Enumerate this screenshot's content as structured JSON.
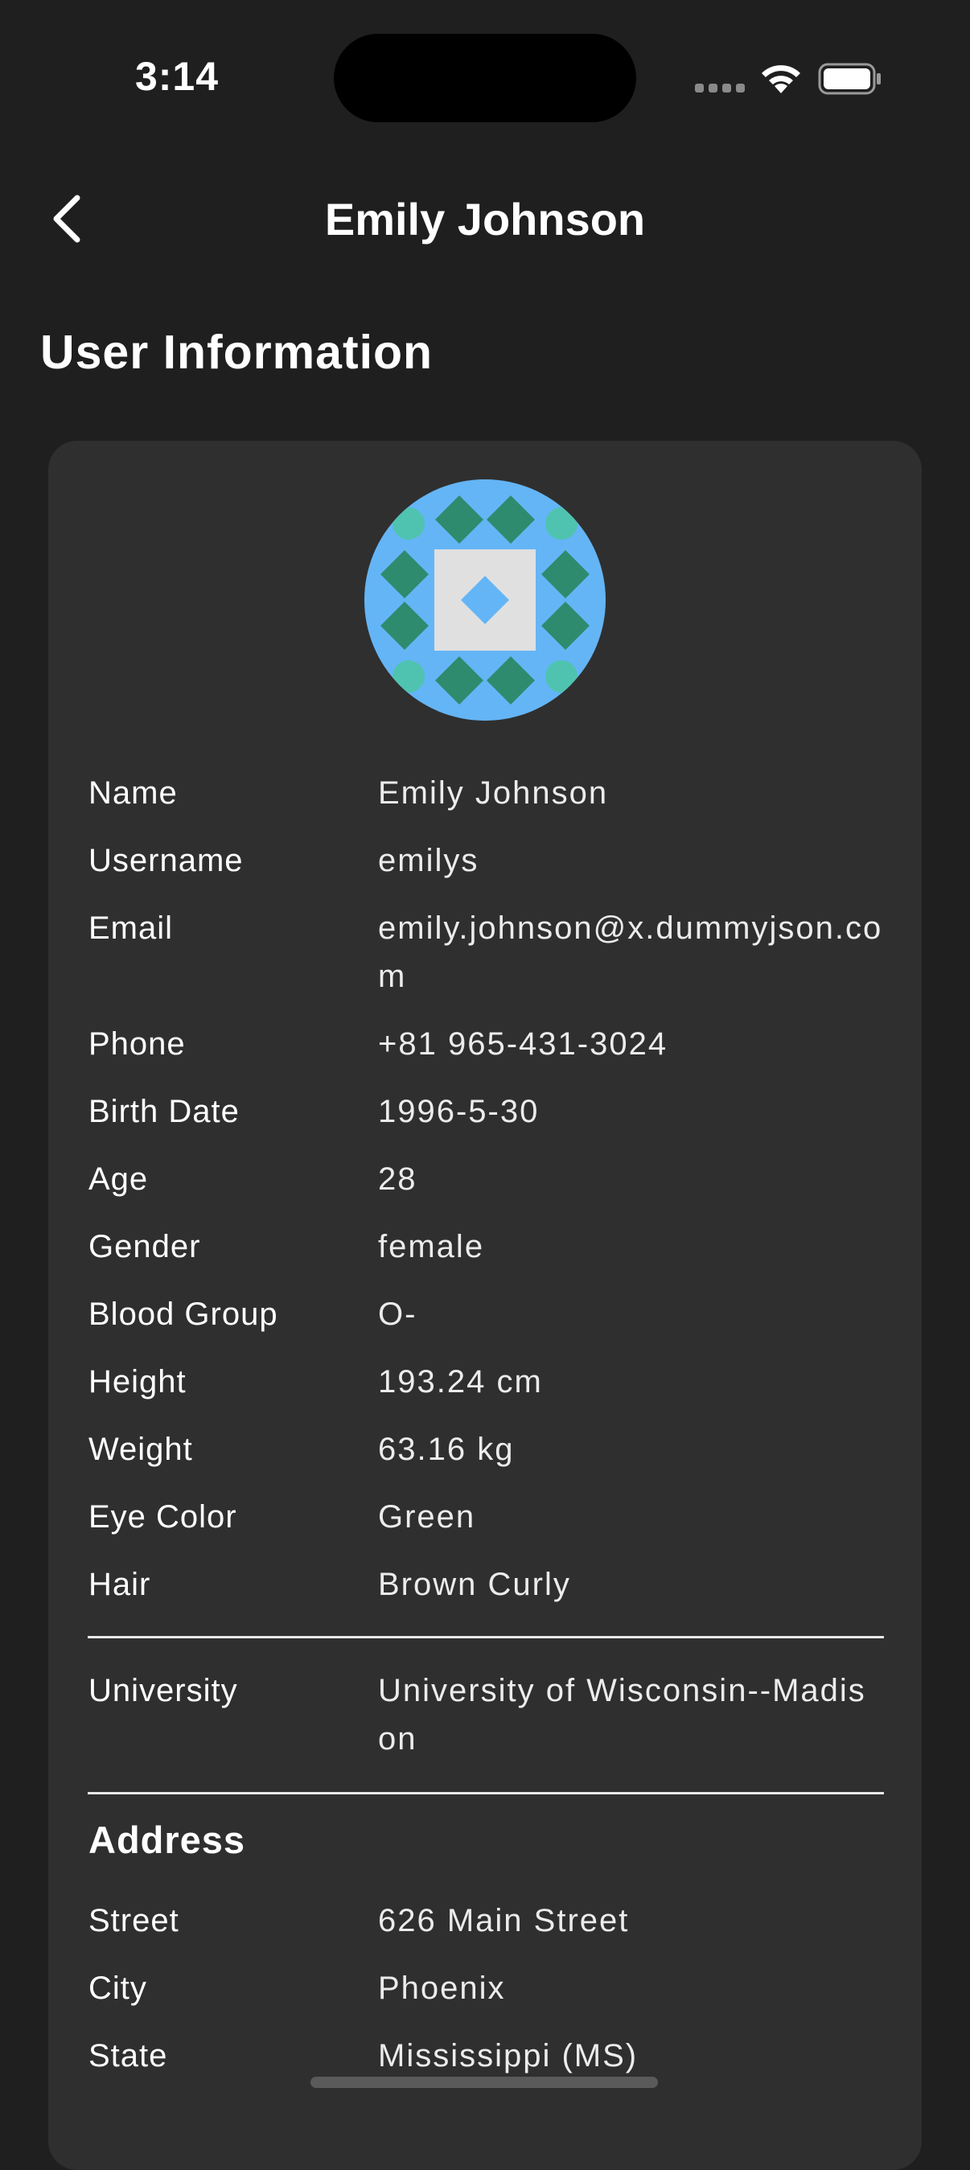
{
  "status": {
    "time": "3:14"
  },
  "nav": {
    "title": "Emily Johnson"
  },
  "section": {
    "title": "User Information"
  },
  "colors": {
    "background": "#1f1f1f",
    "card": "#2f2f2f",
    "avatar_bg": "#64b5f6",
    "avatar_pattern": "#2e8b6e"
  },
  "details": [
    {
      "label": "Name",
      "value": "Emily Johnson"
    },
    {
      "label": "Username",
      "value": "emilys"
    },
    {
      "label": "Email",
      "value": "emily.johnson@x.dummyjson.com"
    },
    {
      "label": "Phone",
      "value": "+81 965-431-3024"
    },
    {
      "label": "Birth Date",
      "value": "1996-5-30"
    },
    {
      "label": "Age",
      "value": "28"
    },
    {
      "label": "Gender",
      "value": "female"
    },
    {
      "label": "Blood Group",
      "value": "O-"
    },
    {
      "label": "Height",
      "value": "193.24 cm"
    },
    {
      "label": "Weight",
      "value": "63.16 kg"
    },
    {
      "label": "Eye Color",
      "value": "Green"
    },
    {
      "label": "Hair",
      "value": "Brown Curly"
    }
  ],
  "education": {
    "label": "University",
    "value": "University of Wisconsin--Madison"
  },
  "address": {
    "title": "Address",
    "rows": [
      {
        "label": "Street",
        "value": "626 Main Street"
      },
      {
        "label": "City",
        "value": "Phoenix"
      },
      {
        "label": "State",
        "value": "Mississippi (MS)"
      }
    ]
  }
}
